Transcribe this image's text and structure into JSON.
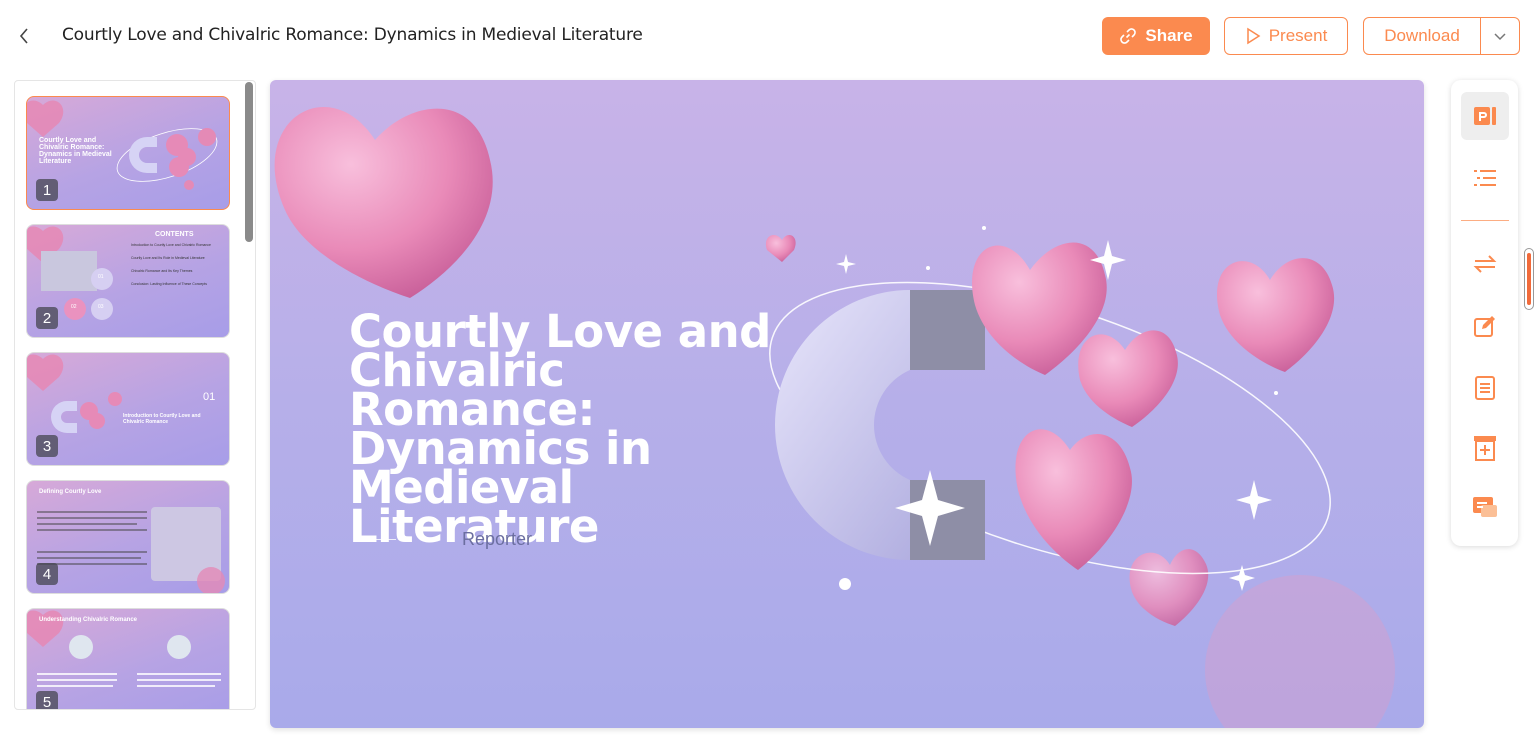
{
  "header": {
    "back_icon": "chevron-left-icon",
    "title": "Courtly Love and Chivalric Romance: Dynamics in Medieval Literature",
    "share_label": "Share",
    "present_label": "Present",
    "download_label": "Download"
  },
  "thumbnails": [
    {
      "number": "1",
      "title": "Courtly Love and Chivalric Romance: Dynamics in Medieval Literature"
    },
    {
      "number": "2",
      "heading": "CONTENTS",
      "items": [
        "Introduction to Courtly Love and Chivalric Romance",
        "Courtly Love and Its Role in Medieval Literature",
        "Chivalric Romance and Its Key Themes",
        "Conclusion: Lasting Influence of These Concepts"
      ],
      "circles": [
        "01",
        "02",
        "03"
      ]
    },
    {
      "number": "3",
      "section": "01",
      "title": "Introduction to Courtly Love and Chivalric Romance"
    },
    {
      "number": "4",
      "title": "Defining Courtly Love"
    },
    {
      "number": "5",
      "title": "Understanding Chivalric Romance"
    }
  ],
  "slide": {
    "title": "Courtly Love and Chivalric Romance: Dynamics in Medieval Literature",
    "reporter": "Reporter"
  },
  "toolbar": {
    "items": [
      "presentation-icon",
      "outline-icon",
      "switch-icon",
      "edit-icon",
      "notes-icon",
      "template-icon",
      "comment-icon"
    ]
  },
  "colors": {
    "accent": "#fb8a4f",
    "slide_bg_top": "#c8b3e8",
    "slide_bg_bottom": "#a9aaea",
    "heart": "#e98ab8"
  }
}
